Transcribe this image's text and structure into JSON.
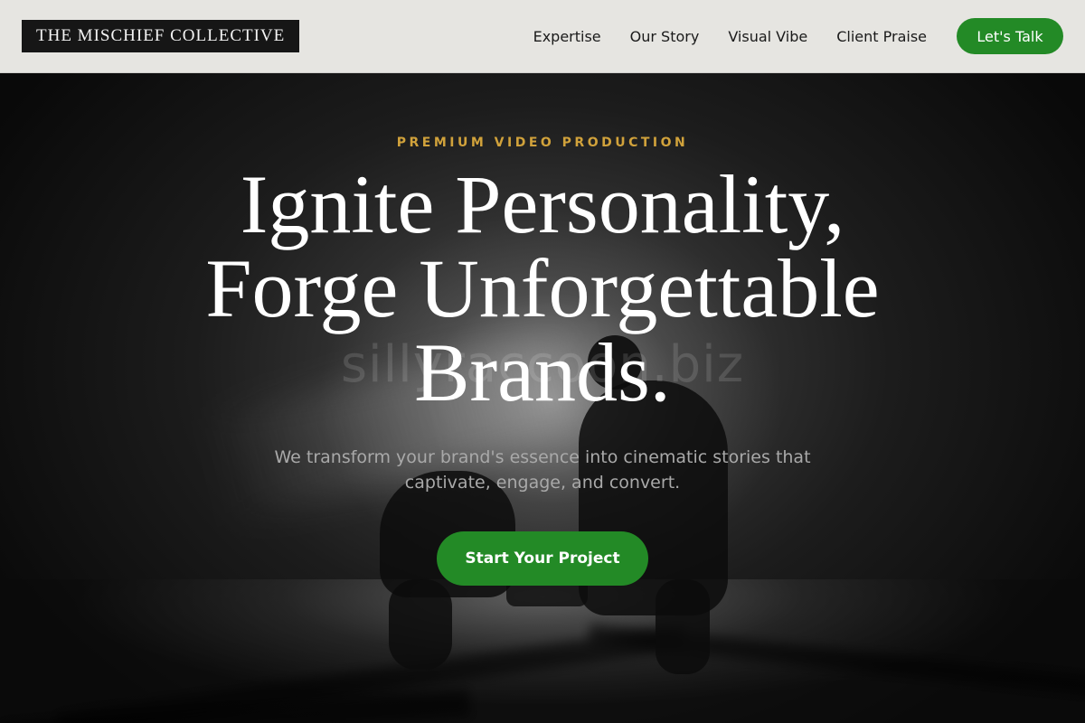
{
  "header": {
    "logo": "THE MISCHIEF COLLECTIVE",
    "nav": [
      "Expertise",
      "Our Story",
      "Visual Vibe",
      "Client Praise"
    ],
    "cta_label": "Let's Talk"
  },
  "hero": {
    "eyebrow": "PREMIUM VIDEO PRODUCTION",
    "headline": "Ignite Personality, Forge Unforgettable Brands.",
    "subtext": "We transform your brand's essence into cinematic stories that captivate, engage, and convert.",
    "cta_label": "Start Your Project",
    "watermark": "sillyraccoon.biz"
  },
  "colors": {
    "accent_green": "#238a26",
    "eyebrow_gold": "#d1a23b",
    "header_bg": "#e6e5e1",
    "logo_bg": "#161616"
  }
}
